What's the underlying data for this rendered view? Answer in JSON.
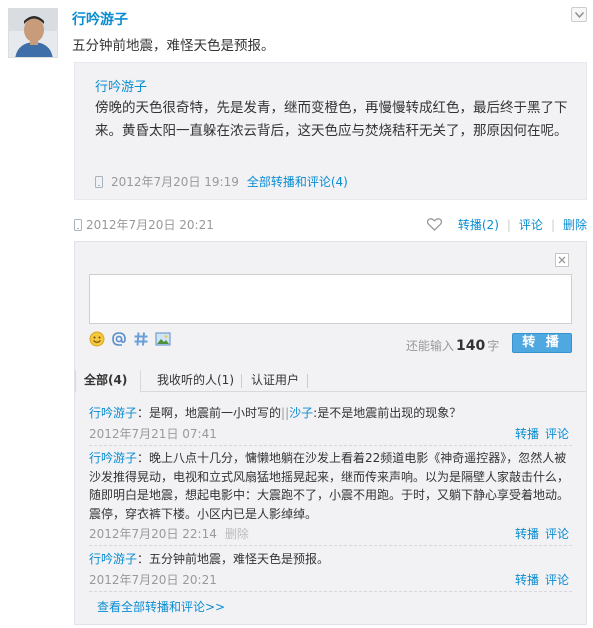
{
  "post": {
    "author": "行吟游子",
    "text": "五分钟前地震，难怪天色是预报。",
    "time": "2012年7月20日 20:21",
    "actions": {
      "repost": "转播(2)",
      "comment": "评论",
      "delete": "删除"
    }
  },
  "repost": {
    "author": "行吟游子",
    "text": "傍晚的天色很奇特，先是发青，继而变橙色，再慢慢转成红色，最后终于黑了下来。黄昏太阳一直躲在浓云背后，这天色应与焚烧秸秆无关了，那原因何在呢。",
    "time": "2012年7月20日 19:19",
    "link": "全部转播和评论(4)"
  },
  "composer": {
    "remain_prefix": "还能输入",
    "remain_count": "140",
    "remain_suffix": "字",
    "submit": "转 播",
    "tools": [
      "smile-icon",
      "at-icon",
      "hashtag-icon",
      "image-icon"
    ]
  },
  "tabs": [
    {
      "label": "全部(4)",
      "active": true
    },
    {
      "label": "我收听的人(1)",
      "active": false
    },
    {
      "label": "认证用户",
      "active": false
    }
  ],
  "comments": [
    {
      "author": "行吟游子",
      "sep": "：",
      "text": "是啊，地震前一小时写的",
      "reply_sep": "||",
      "reply_author": "沙子",
      "reply_text": ":是不是地震前出现的现象？",
      "time": "2012年7月21日 07:41",
      "repost": "转播",
      "comment": "评论"
    },
    {
      "author": "行吟游子",
      "sep": "：",
      "text": "晚上八点十几分，慵懒地躺在沙发上看着22频道电影《神奇遥控器》，忽然人被沙发推得晃动，电视和立式风扇猛地摇晃起来，继而传来声响。以为是隔壁人家敲击什么，随即明白是地震，想起电影中：大震跑不了，小震不用跑。于时，又躺下静心享受着地动。震停，穿衣裤下楼。小区内已是人影绰绰。",
      "time": "2012年7月20日 22:14",
      "delete": "删除",
      "repost": "转播",
      "comment": "评论"
    },
    {
      "author": "行吟游子",
      "sep": "：",
      "text": "五分钟前地震，难怪天色是预报。",
      "time": "2012年7月20日 20:21",
      "repost": "转播",
      "comment": "评论"
    }
  ],
  "more_link": "查看全部转播和评论>>",
  "colors": {
    "link": "#0a8cd2",
    "panel": "#f2f2f5",
    "button": "#4fa8e0"
  }
}
